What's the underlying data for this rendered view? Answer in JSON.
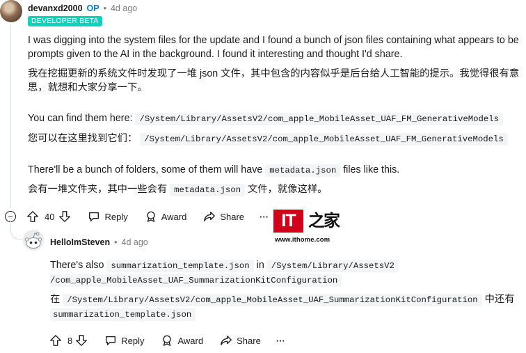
{
  "comment": {
    "author": "devanxd2000",
    "op_tag": "OP",
    "separator": "•",
    "time": "4d ago",
    "flair": "DEVELOPER BETA",
    "para1_line1": "I was digging into the system files for the update and I found a bunch of json files containing what appears to be",
    "para1_line2": "prompts given to the AI in the background. I found it interesting and thought I'd share.",
    "para1_cn_line1": "我在挖掘更新的系统文件时发现了一堆 json 文件，其中包含的内容似乎是后台给人工智能的提示。我觉得很有意",
    "para1_cn_line2": "思，就想和大家分享一下。",
    "para2_prefix": "You can find them here:",
    "para2_code": "/System/Library/AssetsV2/com_apple_MobileAsset_UAF_FM_GenerativeModels",
    "para2_cn_prefix": "您可以在这里找到它们：",
    "para2_cn_code": "/System/Library/AssetsV2/com_apple_MobileAsset_UAF_FM_GenerativeModels",
    "para3_prefix": "There'll be a bunch of folders, some of them will have",
    "para3_code": "metadata.json",
    "para3_suffix": "files like this.",
    "para3_cn_prefix": "会有一堆文件夹，其中一些会有",
    "para3_cn_code": "metadata.json",
    "para3_cn_suffix": "文件，就像这样。",
    "actions": {
      "collapse": "−",
      "votes": "40",
      "reply": "Reply",
      "award": "Award",
      "share": "Share",
      "more": "···"
    }
  },
  "reply": {
    "author": "HelloImSteven",
    "separator": "•",
    "time": "4d ago",
    "line1_prefix": "There's also",
    "line1_code": "summarization_template.json",
    "line1_mid": "in",
    "line1_code2": "/System/Library/AssetsV2",
    "line2_code": "/com_apple_MobileAsset_UAF_SummarizationKitConfiguration",
    "cn_prefix": "在",
    "cn_code": "/System/Library/AssetsV2/com_apple_MobileAsset_UAF_SummarizationKitConfiguration",
    "cn_suffix": "中还有",
    "cn_code2": "summarization_template.json",
    "actions": {
      "votes": "8",
      "reply": "Reply",
      "award": "Award",
      "share": "Share",
      "more": "···"
    }
  },
  "watermark": {
    "logo_text": "IT",
    "logo_char": "之家",
    "url": "www.ithome.com"
  },
  "colors": {
    "flair_bg": "#0dd3bb",
    "op": "#0079d3",
    "watermark_red": "#d0021b"
  },
  "icons": [
    "upvote-icon",
    "downvote-icon",
    "reply-icon",
    "award-icon",
    "share-icon",
    "more-icon",
    "collapse-icon"
  ]
}
